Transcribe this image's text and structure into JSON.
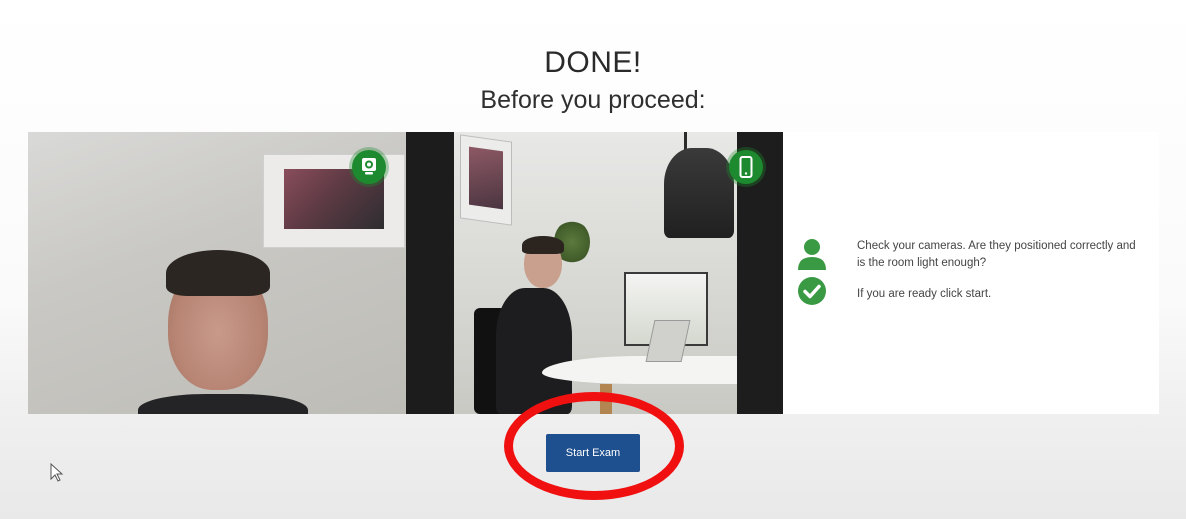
{
  "header": {
    "title": "DONE!",
    "subtitle": "Before you proceed:"
  },
  "cameras": {
    "webcam_icon": "webcam-icon",
    "phone_icon": "smartphone-icon",
    "status_color": "#1e8a2f"
  },
  "info": {
    "person_icon": "person-icon",
    "check_icon": "check-circle-icon",
    "instruction": "Check your cameras. Are they positioned correctly and is the room light enough?",
    "ready_text": "If you are ready click start."
  },
  "actions": {
    "start_label": "Start Exam",
    "button_color": "#1e4f8f",
    "highlight_color": "#f11010"
  }
}
